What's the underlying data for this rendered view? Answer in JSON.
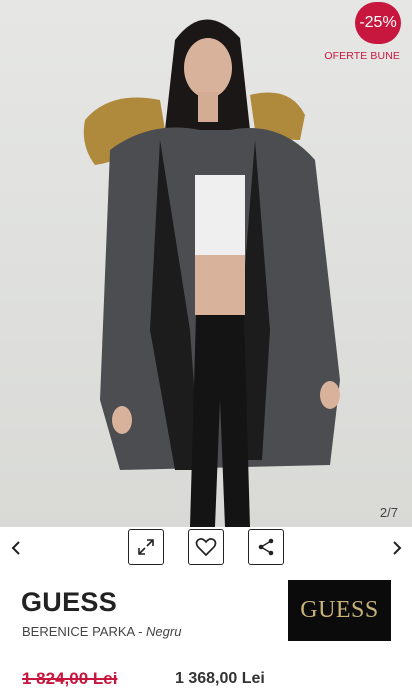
{
  "gallery": {
    "badge_discount": "-25%",
    "badge_caption": "OFERTE BUNE",
    "counter": "2/7"
  },
  "toolbar": {
    "prev_icon": "chevron-left-icon",
    "next_icon": "chevron-right-icon",
    "expand_icon": "expand-arrows-icon",
    "wishlist_icon": "heart-icon",
    "share_icon": "share-icon"
  },
  "product": {
    "brand": "GUESS",
    "name": "BERENICE PARKA",
    "separator": " - ",
    "color": "Negru",
    "logo_text": "GUESS",
    "price_old": "1 824,00 Lei",
    "price_new": "1 368,00 Lei"
  },
  "colors": {
    "accent": "#c8173f",
    "logo_bg": "#0b0b0b",
    "logo_gold": "#c9b27a"
  }
}
